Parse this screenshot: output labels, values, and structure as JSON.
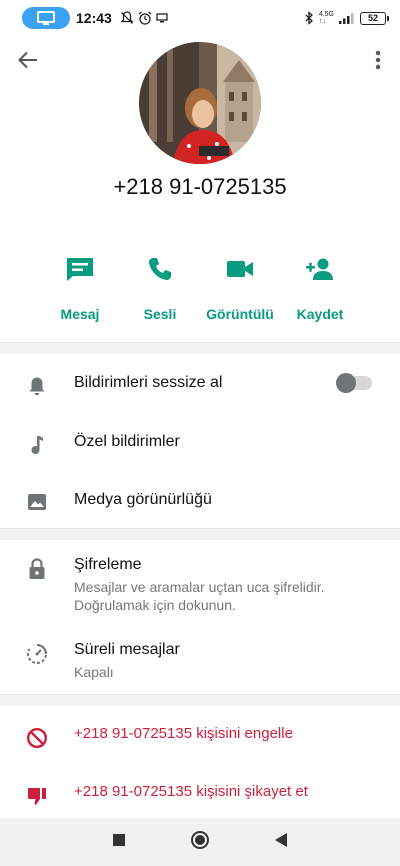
{
  "status_bar": {
    "time": "12:43",
    "network_top": "4.5G",
    "network_bottom": "↑↓",
    "battery": "52"
  },
  "header": {
    "phone_number": "+218 91-0725135"
  },
  "actions": [
    {
      "label": "Mesaj",
      "icon": "message-icon"
    },
    {
      "label": "Sesli",
      "icon": "phone-icon"
    },
    {
      "label": "Görüntülü",
      "icon": "video-icon"
    },
    {
      "label": "Kaydet",
      "icon": "add-person-icon"
    }
  ],
  "settings": {
    "mute": {
      "label": "Bildirimleri sessize al",
      "enabled": false
    },
    "custom_notifications": {
      "label": "Özel bildirimler"
    },
    "media_visibility": {
      "label": "Medya görünürlüğü"
    }
  },
  "security": {
    "encryption": {
      "title": "Şifreleme",
      "subtitle_line1": "Mesajlar ve aramalar uçtan uca şifrelidir.",
      "subtitle_line2": "Doğrulamak için dokunun."
    },
    "disappearing": {
      "title": "Süreli mesajlar",
      "subtitle": "Kapalı"
    }
  },
  "danger": {
    "block": "+218 91-0725135 kişisini engelle",
    "report": "+218 91-0725135 kişisini şikayet et"
  },
  "colors": {
    "accent": "#0a9b80",
    "danger": "#cc1f3d",
    "icon_grey": "#6f7575"
  }
}
